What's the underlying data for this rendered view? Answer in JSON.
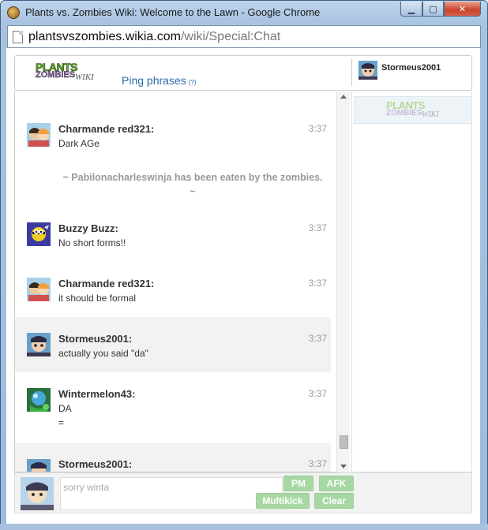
{
  "window": {
    "title": "Plants vs. Zombies Wiki: Welcome to the Lawn - Google Chrome",
    "minimize": "▁",
    "maximize": "▢",
    "close": "✕"
  },
  "urlbar": {
    "domain": "plantsvszombies.wikia.com",
    "path": "/wiki/Special:Chat"
  },
  "header": {
    "logo_line1": "PLANTS",
    "logo_line2": "ZOMBIES",
    "logo_line3": "WIKI",
    "ping_phrases": "Ping phrases",
    "ping_help": "(?)",
    "current_user": "Stormeus2001"
  },
  "messages": [
    {
      "user": "Charmande red321:",
      "time": "3:37",
      "text": "Dark AGe",
      "avatar": "charmande-avatar",
      "highlight": false
    },
    {
      "user": "Buzzy Buzz:",
      "time": "3:37",
      "text": "No short forms!!",
      "avatar": "buzzy-avatar",
      "highlight": false
    },
    {
      "user": "Charmande red321:",
      "time": "3:37",
      "text": "it should be formal",
      "avatar": "charmande-avatar",
      "highlight": false
    },
    {
      "user": "Stormeus2001:",
      "time": "3:37",
      "text": "actually you said \"da\"",
      "avatar": "stormeus-avatar",
      "highlight": true
    },
    {
      "user": "Wintermelon43:",
      "time": "3:37",
      "text": "DA",
      "text2": "=",
      "avatar": "wintermelon-avatar",
      "highlight": false
    },
    {
      "user": "Stormeus2001:",
      "time": "3:37",
      "text": "",
      "avatar": "stormeus-avatar",
      "highlight": true
    }
  ],
  "inline_alert": "~ Pabilonacharleswinja has been eaten by the zombies. ~",
  "input": {
    "value": "sorry winta"
  },
  "buttons": {
    "pm": "PM",
    "afk": "AFK",
    "multikick": "Multikick",
    "clear": "Clear"
  },
  "colors": {
    "link": "#2a6aa8",
    "button_green": "#a7d8a3",
    "highlight_row": "#f2f2f2"
  }
}
